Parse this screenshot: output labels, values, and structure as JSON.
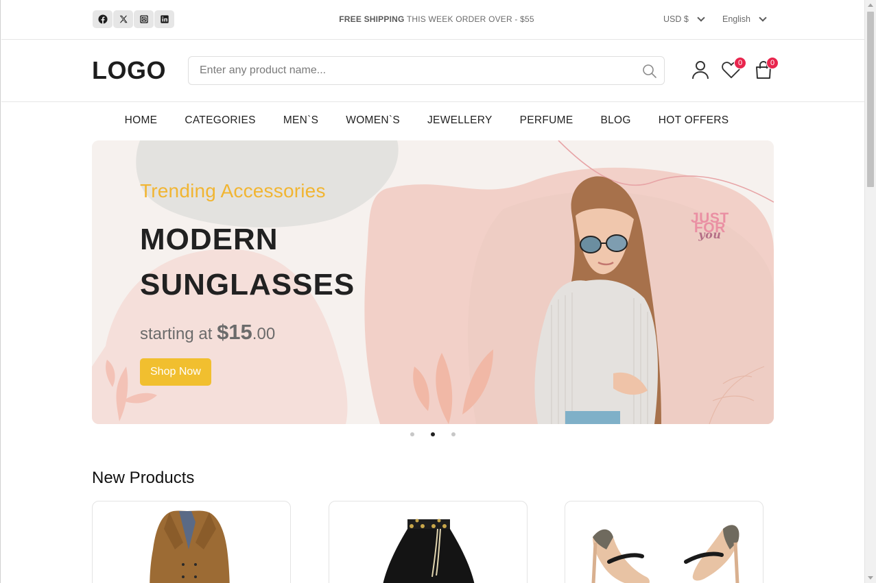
{
  "topbar": {
    "social": [
      {
        "name": "facebook-icon"
      },
      {
        "name": "x-twitter-icon"
      },
      {
        "name": "instagram-icon"
      },
      {
        "name": "linkedin-icon"
      }
    ],
    "shipping_bold": "FREE SHIPPING",
    "shipping_text": "THIS WEEK ORDER OVER - $55",
    "currency": "USD $",
    "language": "English"
  },
  "header": {
    "logo": "LOGO",
    "search_placeholder": "Enter any product name...",
    "wishlist_count": "0",
    "cart_count": "0"
  },
  "nav": {
    "items": [
      "HOME",
      "CATEGORIES",
      "MEN`S",
      "WOMEN`S",
      "JEWELLERY",
      "PERFUME",
      "BLOG",
      "HOT OFFERS"
    ]
  },
  "hero": {
    "subtitle": "Trending Accessories",
    "title_line1": "MODERN",
    "title_line2": "SUNGLASSES",
    "price_prefix": "starting at",
    "price_main": "$15",
    "price_cents": ".00",
    "button": "Shop Now",
    "badge_line1": "JUST",
    "badge_line2": "FOR",
    "badge_line3": "you",
    "active_slide": 2,
    "slide_count": 3
  },
  "products": {
    "title": "New Products",
    "items": [
      {
        "name": "coat-image"
      },
      {
        "name": "skirt-image"
      },
      {
        "name": "heels-image"
      }
    ]
  },
  "colors": {
    "accent": "#f1bf2f",
    "subtitle": "#f1b532",
    "badge": "#e8254d",
    "hero_bg": "#f6f1ee"
  }
}
